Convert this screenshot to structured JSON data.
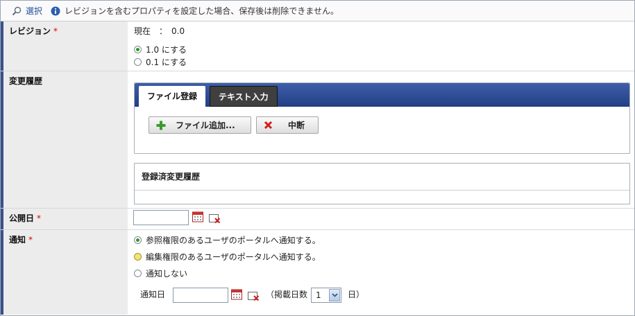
{
  "toolbar": {
    "select_label": "選択",
    "info_message": "レビジョンを含むプロパティを設定した場合、保存後は削除できません。"
  },
  "revision": {
    "label": "レビジョン",
    "required_mark": "*",
    "current_label": "現在　：　0.0",
    "options": [
      "1.0 にする",
      "0.1 にする"
    ],
    "selected": 0
  },
  "history": {
    "label": "変更履歴",
    "tabs": [
      "ファイル登録",
      "テキスト入力"
    ],
    "active_tab": 0,
    "add_file_button": "ファイル追加...",
    "cancel_button": "中断",
    "registered_header": "登録済変更履歴"
  },
  "publish_date": {
    "label": "公開日",
    "required_mark": "*",
    "value": ""
  },
  "notification": {
    "label": "通知",
    "required_mark": "*",
    "options": [
      "参照権限のあるユーザのポータルへ通知する。",
      "編集権限のあるユーザのポータルへ通知する。",
      "通知しない"
    ],
    "selected": 0,
    "notify_date_label": "通知日",
    "notify_date_value": "",
    "days_label_prefix": "（掲載日数",
    "days_value": "1",
    "days_label_suffix": "日）"
  },
  "colors": {
    "label_bar": "#3b4f8a",
    "tab_bar": "#2f4f98",
    "required": "#dd0000",
    "link": "#224f9a"
  }
}
